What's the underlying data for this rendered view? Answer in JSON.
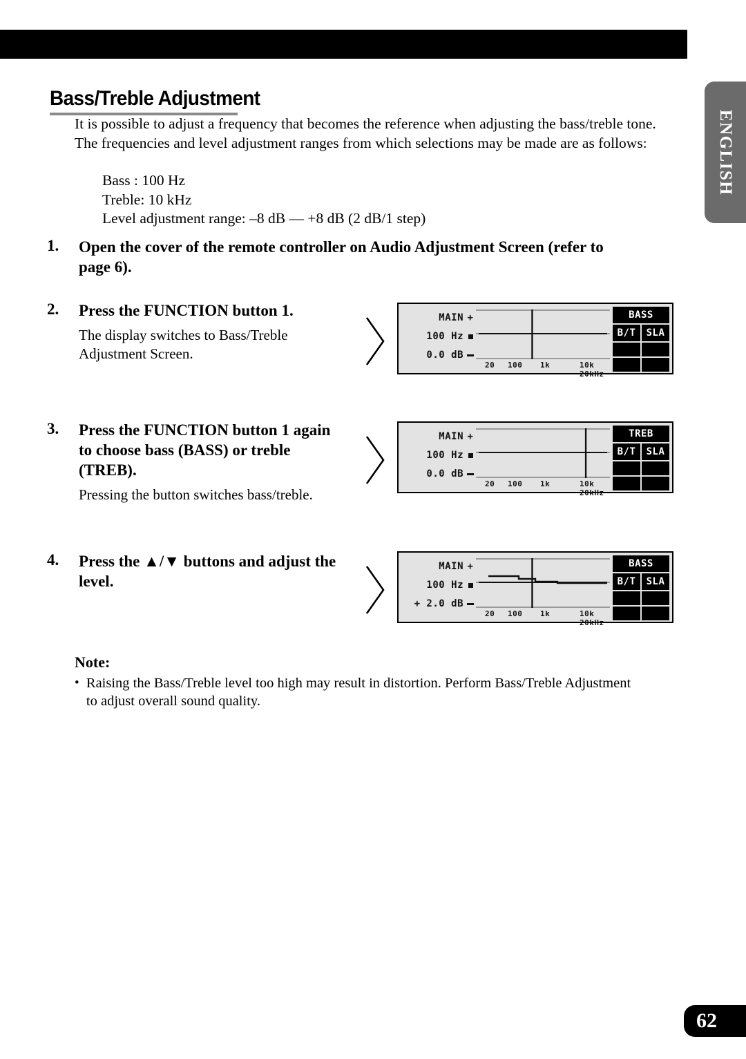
{
  "language_tab": "ENGLISH",
  "page_number": "62",
  "heading": "Bass/Treble Adjustment",
  "intro": "It is possible to adjust a frequency that becomes the reference when adjusting the bass/treble tone. The frequencies and level adjustment ranges from which selections may be made are as follows:",
  "specs": [
    "Bass : 100 Hz",
    "Treble: 10 kHz",
    "Level adjustment range: –8 dB — +8 dB (2 dB/1 step)"
  ],
  "steps": [
    {
      "num": "1.",
      "head": "Open the cover of the remote controller on Audio Adjustment Screen (refer to page 6).",
      "desc": ""
    },
    {
      "num": "2.",
      "head": "Press the FUNCTION button 1.",
      "desc": "The display switches to Bass/Treble Adjustment Screen."
    },
    {
      "num": "3.",
      "head": "Press the FUNCTION button 1 again to choose bass (BASS) or treble (TREB).",
      "desc": "Pressing the button switches bass/treble."
    },
    {
      "num": "4.",
      "head": "Press the ▲/▼ buttons and adjust the level.",
      "desc": ""
    }
  ],
  "note": {
    "title": "Note:",
    "bullet": "•",
    "text": "Raising the Bass/Treble level too high may result in distortion. Perform Bass/Treble Adjustment to adjust overall sound quality."
  },
  "displays": [
    {
      "source": "MAIN",
      "frequency": "100 Hz",
      "level": "0.0 dB",
      "mark_plus": "+",
      "mark_minus": "–",
      "mode_button": "BASS",
      "button_bt": "B/T",
      "button_sla": "SLA",
      "scale": [
        "20",
        "100",
        "1k",
        "10k 20kHz"
      ],
      "cursor_pct": 42,
      "curve": "flat"
    },
    {
      "source": "MAIN",
      "frequency": "100 Hz",
      "level": "0.0 dB",
      "mark_plus": "+",
      "mark_minus": "–",
      "mode_button": "TREB",
      "button_bt": "B/T",
      "button_sla": "SLA",
      "scale": [
        "20",
        "100",
        "1k",
        "10k 20kHz"
      ],
      "cursor_pct": 82,
      "curve": "flat"
    },
    {
      "source": "MAIN",
      "frequency": "100 Hz",
      "level": "+ 2.0 dB",
      "mark_plus": "+",
      "mark_minus": "–",
      "mode_button": "BASS",
      "button_bt": "B/T",
      "button_sla": "SLA",
      "scale": [
        "20",
        "100",
        "1k",
        "10k 20kHz"
      ],
      "cursor_pct": 42,
      "curve": "bass_boost"
    }
  ]
}
